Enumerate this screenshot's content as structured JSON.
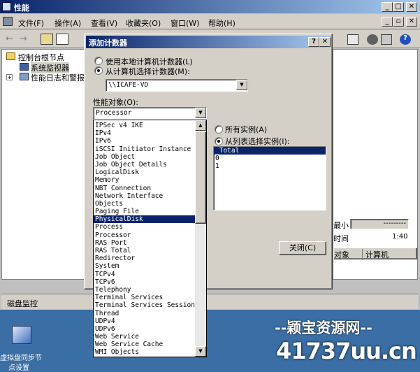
{
  "window": {
    "title": "性能"
  },
  "menu": [
    "文件(F)",
    "操作(A)",
    "查看(V)",
    "收藏夹(O)",
    "窗口(W)",
    "帮助(H)"
  ],
  "tree": {
    "root": "控制台根节点",
    "child1": "系统监视器",
    "child2": "性能日志和警报"
  },
  "status": {
    "left": "磁盘监控"
  },
  "desktop": {
    "icon_label_line1": "虚拟盘同步节",
    "icon_label_line2": "点设置"
  },
  "watermark": {
    "line1": "--颖宝资源网--",
    "line2": "41737uu.cn"
  },
  "right_panel": {
    "min_label": "最小",
    "min_value": "---------",
    "time_label": "时间",
    "time_value": "1:40",
    "col1": "对象",
    "col2": "计算机"
  },
  "dialog": {
    "title": "添加计数器",
    "help": "?",
    "close": "✕",
    "radio_local": "使用本地计算机计数器(L)",
    "radio_remote": "从计算机选择计数器(M):",
    "computer": "\\\\ICAFE-VD",
    "perf_object_label": "性能对象(O):",
    "perf_object_value": "Processor",
    "all_instances": "所有实例(A)",
    "select_instances": "从列表选择实例(I):",
    "instances": [
      "_Total",
      "0",
      "1"
    ],
    "close_button": "关闭(C)",
    "objects": [
      "IPSec v4 IKE",
      "IPv4",
      "IPv6",
      "iSCSI Initiator Instance",
      "Job Object",
      "Job Object Details",
      "LogicalDisk",
      "Memory",
      "NBT Connection",
      "Network Interface",
      "Objects",
      "Paging File",
      "PhysicalDisk",
      "Process",
      "Processor",
      "RAS Port",
      "RAS Total",
      "Redirector",
      "System",
      "TCPv4",
      "TCPv6",
      "Telephony",
      "Terminal Services",
      "Terminal Services Session",
      "Thread",
      "UDPv4",
      "UDPv6",
      "Web Service",
      "Web Service Cache",
      "WMI Objects"
    ],
    "selected_object": "PhysicalDisk"
  }
}
